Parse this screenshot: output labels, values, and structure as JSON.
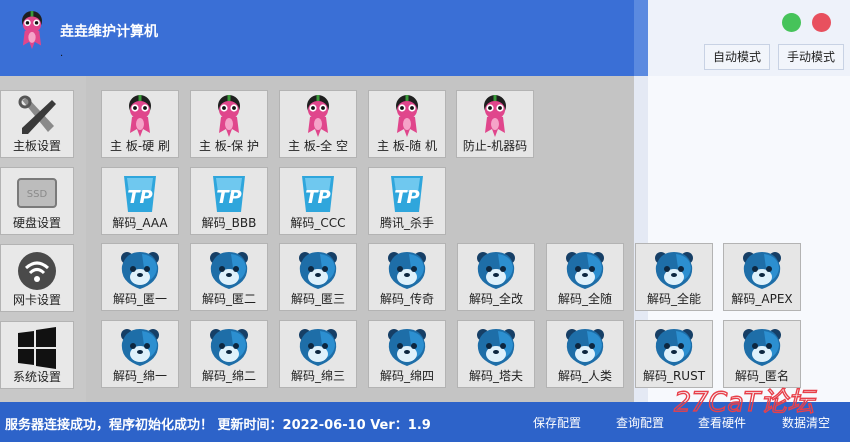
{
  "header": {
    "title": "垚垚维护计算机",
    "subtitle": ".",
    "logo_icon": "mascot-logo-icon",
    "auto_mode_label": "自动模式",
    "manual_mode_label": "手动模式"
  },
  "sidebar": {
    "items": [
      {
        "label": "主板设置",
        "icon": "tools-icon"
      },
      {
        "label": "硬盘设置",
        "icon": "ssd-icon"
      },
      {
        "label": "网卡设置",
        "icon": "wifi-icon"
      },
      {
        "label": "系统设置",
        "icon": "windows-icon"
      }
    ]
  },
  "grid": {
    "row1": [
      {
        "label": "主 板-硬 刷",
        "icon": "mascot-icon"
      },
      {
        "label": "主 板-保 护",
        "icon": "mascot-icon"
      },
      {
        "label": "主 板-全 空",
        "icon": "mascot-icon"
      },
      {
        "label": "主 板-随 机",
        "icon": "mascot-icon"
      },
      {
        "label": "防止-机器码",
        "icon": "mascot-icon"
      }
    ],
    "row2": [
      {
        "label": "解码_AAA",
        "icon": "tp-icon"
      },
      {
        "label": "解码_BBB",
        "icon": "tp-icon"
      },
      {
        "label": "解码_CCC",
        "icon": "tp-icon"
      },
      {
        "label": "腾讯_杀手",
        "icon": "tp-icon"
      }
    ],
    "row3": [
      {
        "label": "解码_匿一",
        "icon": "bear-icon"
      },
      {
        "label": "解码_匿二",
        "icon": "bear-icon"
      },
      {
        "label": "解码_匿三",
        "icon": "bear-icon"
      },
      {
        "label": "解码_传奇",
        "icon": "bear-icon"
      },
      {
        "label": "解码_全改",
        "icon": "bear-icon"
      },
      {
        "label": "解码_全随",
        "icon": "bear-icon"
      },
      {
        "label": "解码_全能",
        "icon": "bear-icon"
      },
      {
        "label": "解码_APEX",
        "icon": "bear-icon"
      }
    ],
    "row4": [
      {
        "label": "解码_绵一",
        "icon": "bear-icon"
      },
      {
        "label": "解码_绵二",
        "icon": "bear-icon"
      },
      {
        "label": "解码_绵三",
        "icon": "bear-icon"
      },
      {
        "label": "解码_绵四",
        "icon": "bear-icon"
      },
      {
        "label": "解码_塔夫",
        "icon": "bear-icon"
      },
      {
        "label": "解码_人类",
        "icon": "bear-icon"
      },
      {
        "label": "解码_RUST",
        "icon": "bear-icon"
      },
      {
        "label": "解码_匿名",
        "icon": "bear-icon"
      }
    ]
  },
  "footer": {
    "status": "服务器连接成功，程序初始化成功！ 更新时间：2022-06-10 Ver：1.9",
    "save_label": "保存配置",
    "query_label": "查询配置",
    "hardware_label": "查看硬件",
    "clear_label": "数据清空"
  },
  "watermark": {
    "text": "27CaT论坛"
  },
  "colors": {
    "header_blue": "#3a6fd6",
    "footer_blue": "#2d63c9",
    "mascot_pink": "#e0468c",
    "tp_blue": "#2fa6dc",
    "bear_blue": "#1e6ea8",
    "watermark_red": "#e8404a"
  }
}
